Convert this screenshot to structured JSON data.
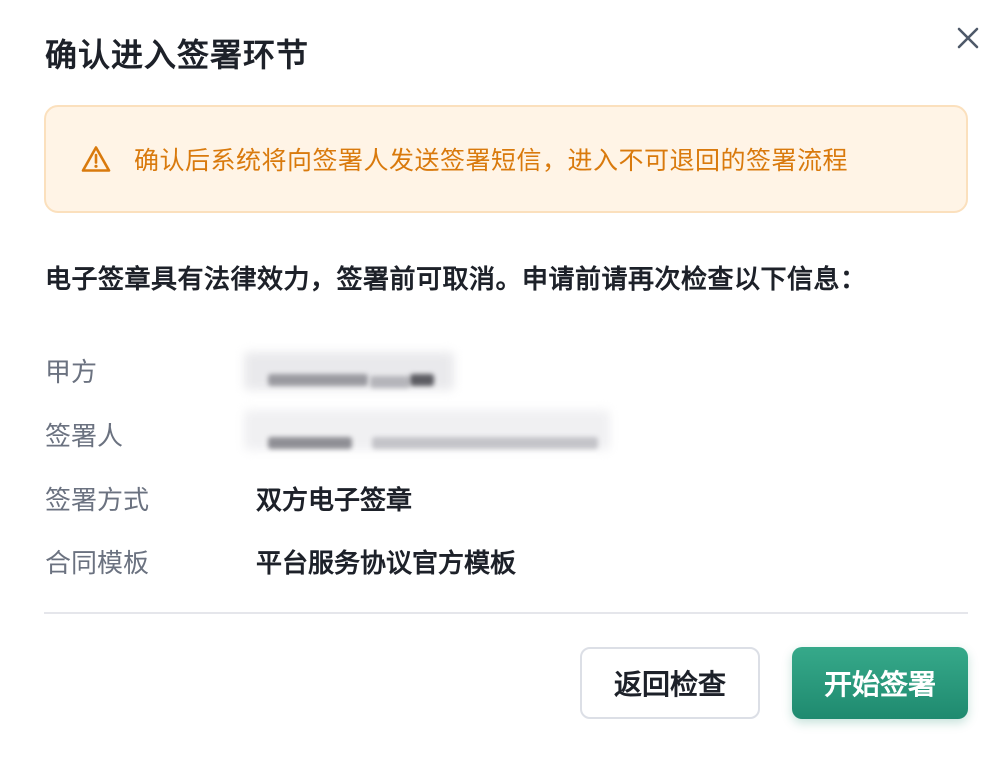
{
  "dialog": {
    "title": "确认进入签署环节",
    "close_icon": "close-icon"
  },
  "warning": {
    "icon": "warning-triangle-icon",
    "text": "确认后系统将向签署人发送签署短信，进入不可退回的签署流程",
    "text_color": "#d97a0d",
    "background": "#fff4e6"
  },
  "notice": {
    "text": "电子签章具有法律效力，签署前可取消。申请前请再次检查以下信息："
  },
  "info": {
    "party_a_label": "甲方",
    "signer_label": "签署人",
    "sign_method_label": "签署方式",
    "sign_method_value": "双方电子签章",
    "template_label": "合同模板",
    "template_value": "平台服务协议官方模板"
  },
  "actions": {
    "back_label": "返回检查",
    "start_label": "开始签署",
    "primary_color": "#2a9d7e"
  }
}
